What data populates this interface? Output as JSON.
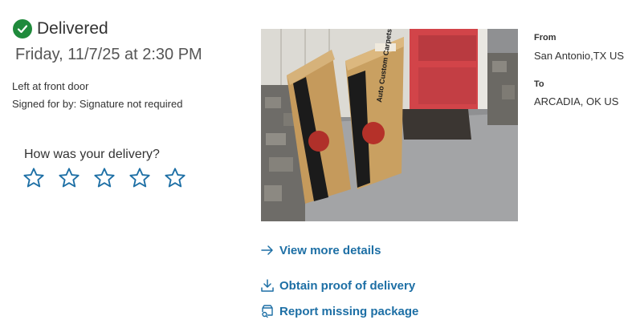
{
  "status": {
    "label": "Delivered",
    "date": "Friday, 11/7/25 at 2:30 PM",
    "left_at": "Left at front door",
    "signed_for": "Signed for by: Signature not required",
    "accent_color": "#1f8a3b"
  },
  "rating": {
    "question": "How was your delivery?",
    "max_stars": 5,
    "selected": 0,
    "star_color": "#1d6fa5"
  },
  "photo": {
    "box_label": "Auto Custom Carpets, Inc."
  },
  "actions": {
    "view_details": "View more details",
    "proof": "Obtain proof of delivery",
    "report_missing": "Report missing package",
    "link_color": "#1d6fa5"
  },
  "shipment": {
    "from_label": "From",
    "from_value": "San Antonio,TX US",
    "to_label": "To",
    "to_value": "ARCADIA, OK US"
  },
  "icons": [
    "check-circle-icon",
    "star-outline-icon",
    "arrow-right-icon",
    "download-icon",
    "search-package-icon"
  ]
}
